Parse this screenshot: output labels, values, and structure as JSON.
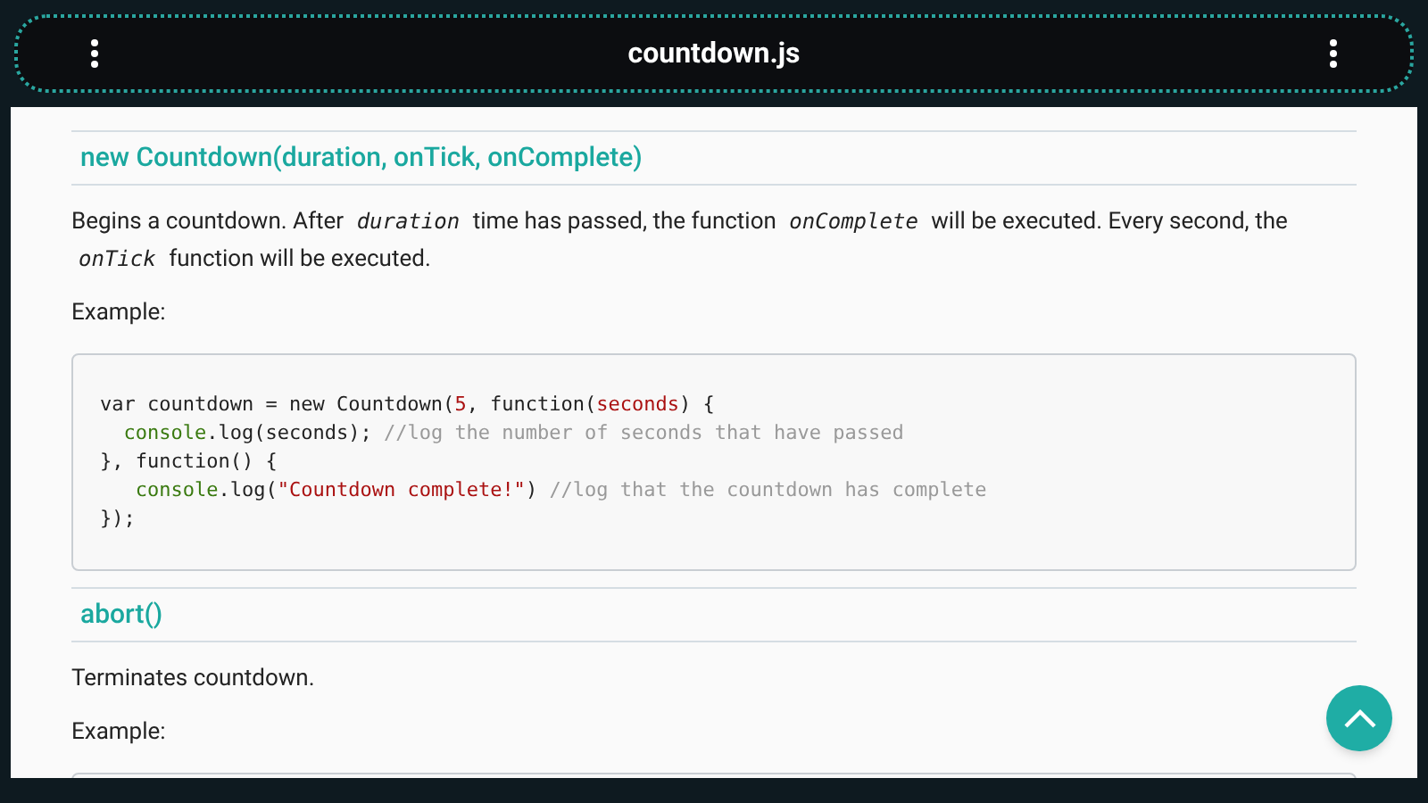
{
  "app_bar": {
    "title": "countdown.js"
  },
  "sections": [
    {
      "heading": "new Countdown(duration, onTick, onComplete)",
      "description": [
        {
          "kind": "text",
          "text": "Begins a countdown. After "
        },
        {
          "kind": "code",
          "text": "duration"
        },
        {
          "kind": "text",
          "text": " time has passed, the function "
        },
        {
          "kind": "code",
          "text": "onComplete"
        },
        {
          "kind": "text",
          "text": " will be executed. Every second, the "
        },
        {
          "kind": "code",
          "text": "onTick"
        },
        {
          "kind": "text",
          "text": " function will be executed."
        }
      ],
      "example_label": "Example:",
      "code_lines": [
        [
          {
            "kind": "plain",
            "text": "var countdown = new Countdown("
          },
          {
            "kind": "literal",
            "text": "5"
          },
          {
            "kind": "plain",
            "text": ", function("
          },
          {
            "kind": "literal",
            "text": "seconds"
          },
          {
            "kind": "plain",
            "text": ") {"
          }
        ],
        [
          {
            "kind": "builtin",
            "text": "  console"
          },
          {
            "kind": "plain",
            "text": ".log(seconds); "
          },
          {
            "kind": "comment",
            "text": "//log the number of seconds that have passed"
          }
        ],
        [
          {
            "kind": "plain",
            "text": "}, function() {"
          }
        ],
        [
          {
            "kind": "builtin",
            "text": "   console"
          },
          {
            "kind": "plain",
            "text": ".log("
          },
          {
            "kind": "literal",
            "text": "\"Countdown complete!\""
          },
          {
            "kind": "plain",
            "text": ") "
          },
          {
            "kind": "comment",
            "text": "//log that the countdown has complete"
          }
        ],
        [
          {
            "kind": "plain",
            "text": "});"
          }
        ]
      ]
    },
    {
      "heading": "abort()",
      "description": [
        {
          "kind": "text",
          "text": "Terminates countdown."
        }
      ],
      "example_label": "Example:"
    }
  ]
}
